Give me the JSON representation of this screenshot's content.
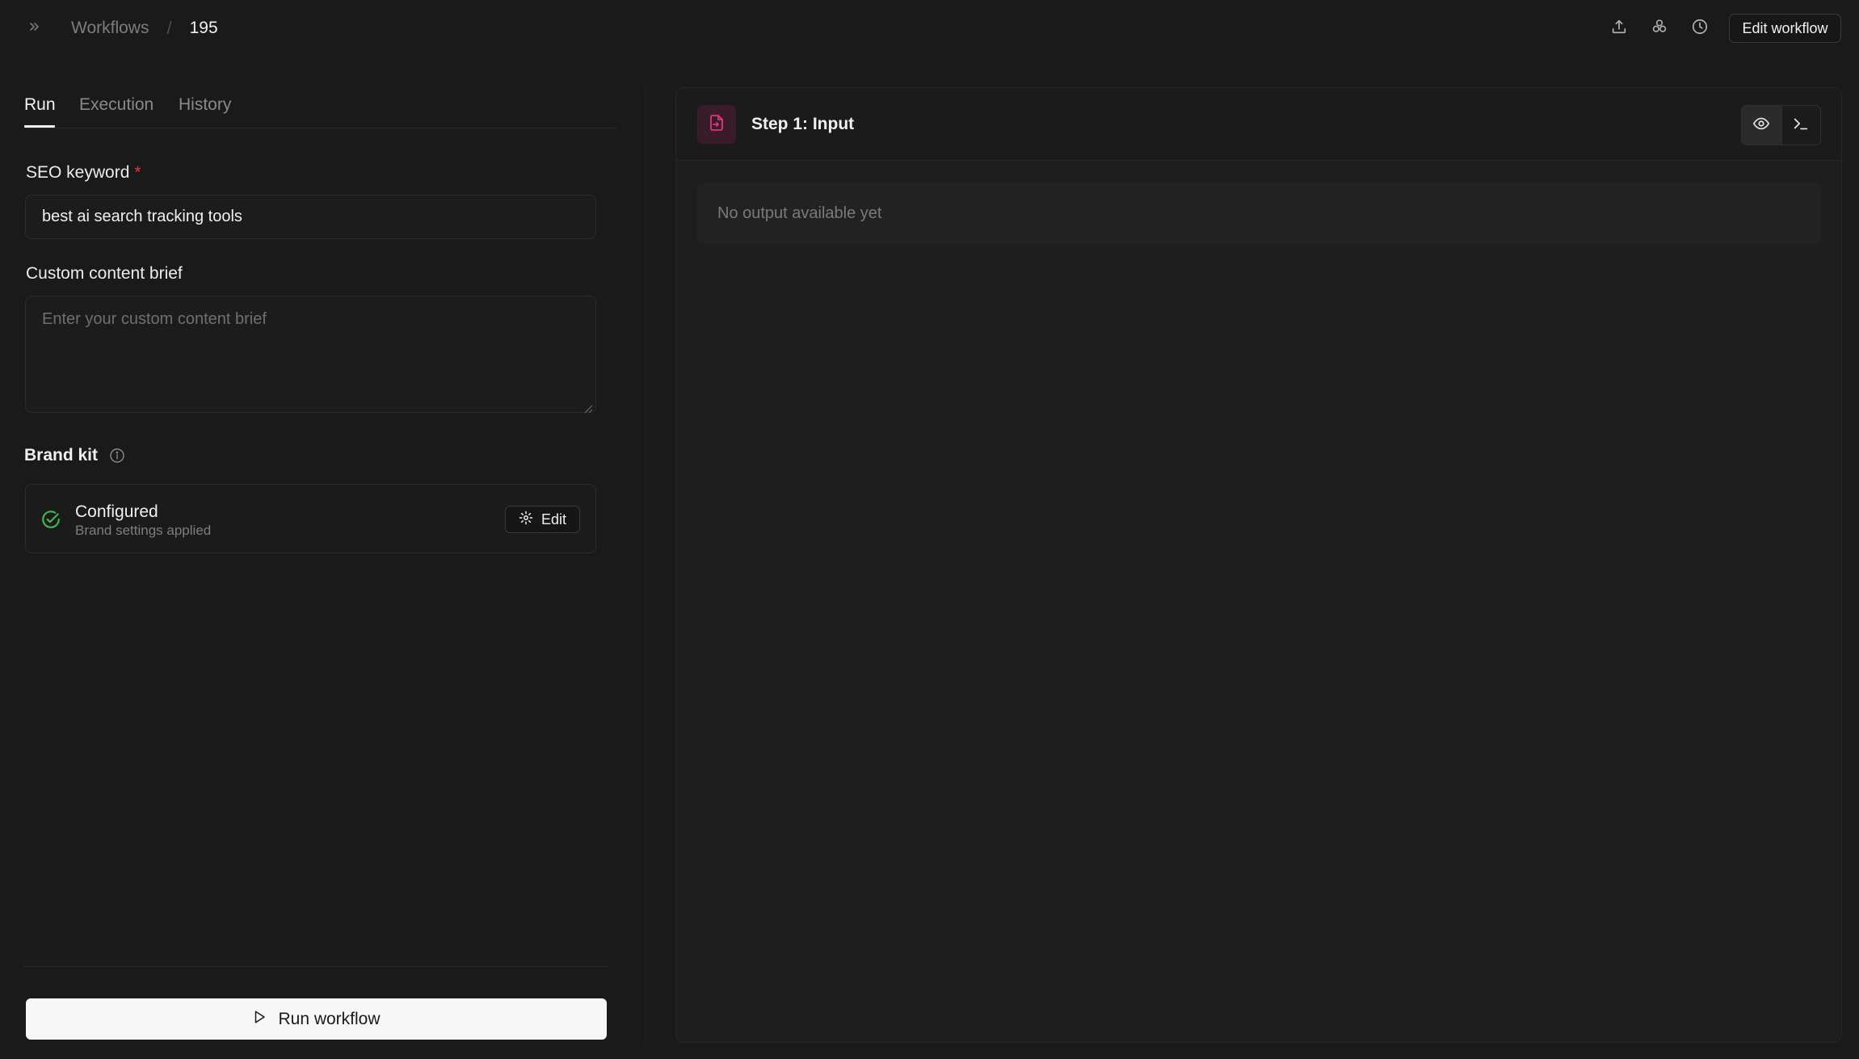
{
  "topbar": {
    "breadcrumb_root": "Workflows",
    "breadcrumb_separator": "/",
    "breadcrumb_current": "195",
    "edit_workflow_label": "Edit workflow",
    "icons": [
      "chevrons-right-icon",
      "upload-icon",
      "components-icon",
      "clock-icon"
    ]
  },
  "tabs": [
    {
      "label": "Run",
      "active": true
    },
    {
      "label": "Execution",
      "active": false
    },
    {
      "label": "History",
      "active": false
    }
  ],
  "form": {
    "seo_keyword": {
      "label": "SEO keyword",
      "required_marker": "*",
      "value": "best ai search tracking tools"
    },
    "custom_brief": {
      "label": "Custom content brief",
      "placeholder": "Enter your custom content brief"
    },
    "brand_kit": {
      "label": "Brand kit",
      "status_title": "Configured",
      "status_subtitle": "Brand settings applied",
      "edit_label": "Edit"
    },
    "run_label": "Run workflow"
  },
  "step": {
    "title": "Step 1: Input",
    "empty_output": "No output available yet"
  },
  "colors": {
    "background": "#1a1a1a",
    "accent_pink": "#e0367d",
    "success_green": "#3fb950",
    "required_red": "#e03a3a"
  }
}
